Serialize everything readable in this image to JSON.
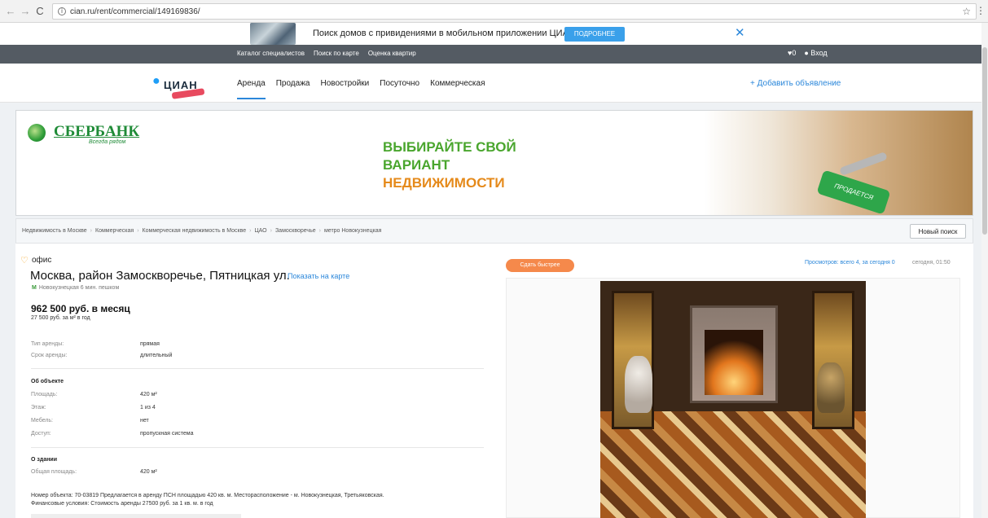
{
  "browser": {
    "url": "cian.ru/rent/commercial/149169836/",
    "back": "←",
    "forward": "→",
    "reload": "C",
    "info": "i",
    "star": "☆",
    "menu": "⋮"
  },
  "promo": {
    "text": "Поиск домов с привидениями в мобильном приложении ЦИАН",
    "button": "ПОДРОБНЕЕ",
    "close": "✕"
  },
  "topbar": {
    "links": [
      "Каталог специалистов",
      "Поиск по карте",
      "Оценка квартир"
    ],
    "favorites": "♥0",
    "login": "Вход"
  },
  "header": {
    "logo": "ЦИАН",
    "nav": [
      "Аренда",
      "Продажа",
      "Новостройки",
      "Посуточно",
      "Коммерческая"
    ],
    "add_listing": "+ Добавить объявление"
  },
  "banner": {
    "brand": "СБЕРБАНК",
    "brand_sub": "Всегда рядом",
    "slogan_line1": "ВЫБИРАЙТЕ СВОЙ",
    "slogan_line2": "ВАРИАНТ",
    "slogan_line3": "НЕДВИЖИМОСТИ",
    "tag_text": "ПРОДАЕТСЯ"
  },
  "breadcrumbs": {
    "items": [
      "Недвижимость в Москве",
      "Коммерческая",
      "Коммерческая недвижимость в Москве",
      "ЦАО",
      "Замоскворечье",
      "метро Новокузнецкая"
    ],
    "separator": "›",
    "new_search": "Новый поиск"
  },
  "listing": {
    "type": "офис",
    "address": "Москва, район Замоскворечье, Пятницкая ул.",
    "map_link": "Показать на карте",
    "metro": "Новокузнецкая 6 мин. пешком",
    "metro_icon": "М",
    "price": "962 500 руб. в месяц",
    "price_sub": "27 500 руб. за м² в год",
    "lease": [
      {
        "label": "Тип аренды:",
        "value": "прямая"
      },
      {
        "label": "Срок аренды:",
        "value": "длительный"
      }
    ],
    "object_title": "Об объекте",
    "object": [
      {
        "label": "Площадь:",
        "value": "420 м²"
      },
      {
        "label": "Этаж:",
        "value": "1 из 4"
      },
      {
        "label": "Мебель:",
        "value": "нет"
      },
      {
        "label": "Доступ:",
        "value": "пропускная система"
      }
    ],
    "building_title": "О здании",
    "building": [
      {
        "label": "Общая площадь:",
        "value": "420 м²"
      }
    ],
    "description_line1": "Номер объекта: 70-03819 Предлагается в аренду ПСН площадью 420 кв. м. Месторасположение - м. Новокузнецкая, Третьяковская.",
    "description_line2": "Финансовые условия: Стоимость аренды 27500 руб. за 1 кв. м. в год",
    "rent_fast_button": "Сдать быстрее",
    "views": "Просмотров: всего 4, за сегодня 0",
    "date": "сегодня, 01:50"
  },
  "colors": {
    "accent": "#2b87da",
    "darkbar": "#545b63",
    "orange": "#f5894b",
    "sber_green": "#1f8b37"
  }
}
